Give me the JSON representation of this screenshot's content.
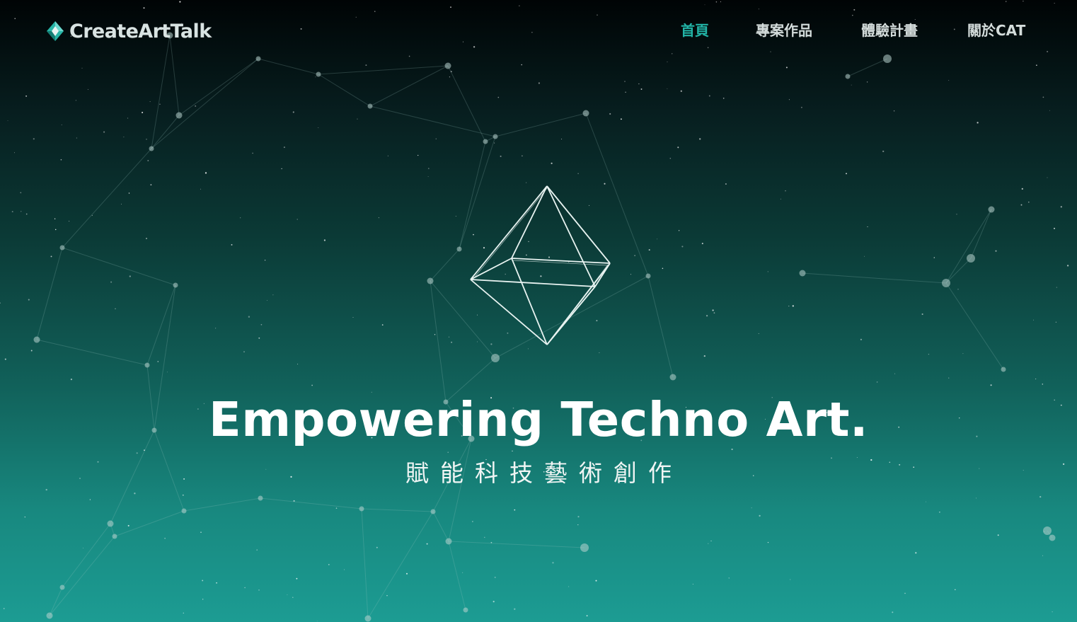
{
  "site": {
    "brand_name": "CreateArtTalk",
    "brand_icon": "diamond-logo-icon",
    "accent_color": "#22b3a6"
  },
  "nav": {
    "items": [
      {
        "label": "首頁",
        "active": true
      },
      {
        "label": "專案作品",
        "active": false
      },
      {
        "label": "體驗計畫",
        "active": false
      },
      {
        "label": "關於CAT",
        "active": false
      }
    ]
  },
  "hero": {
    "title": "Empowering Techno Art.",
    "subtitle": "賦能科技藝術創作",
    "shape_icon": "octahedron-wireframe-icon",
    "background": {
      "gradient_top": "#000405",
      "gradient_bottom": "#1c9c93",
      "effect": "particle-network"
    }
  }
}
